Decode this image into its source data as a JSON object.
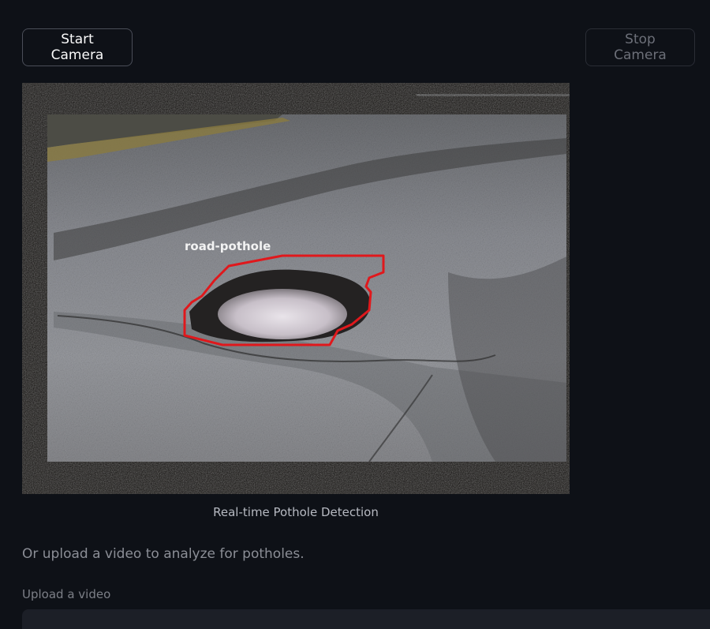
{
  "controls": {
    "start_label": "Start Camera",
    "stop_label": "Stop Camera"
  },
  "video_feed": {
    "caption": "Real-time Pothole Detection",
    "detection_label": "road-pothole",
    "box_color": "#e0181c"
  },
  "upload": {
    "hint": "Or upload a video to analyze for potholes.",
    "label": "Upload a video"
  }
}
